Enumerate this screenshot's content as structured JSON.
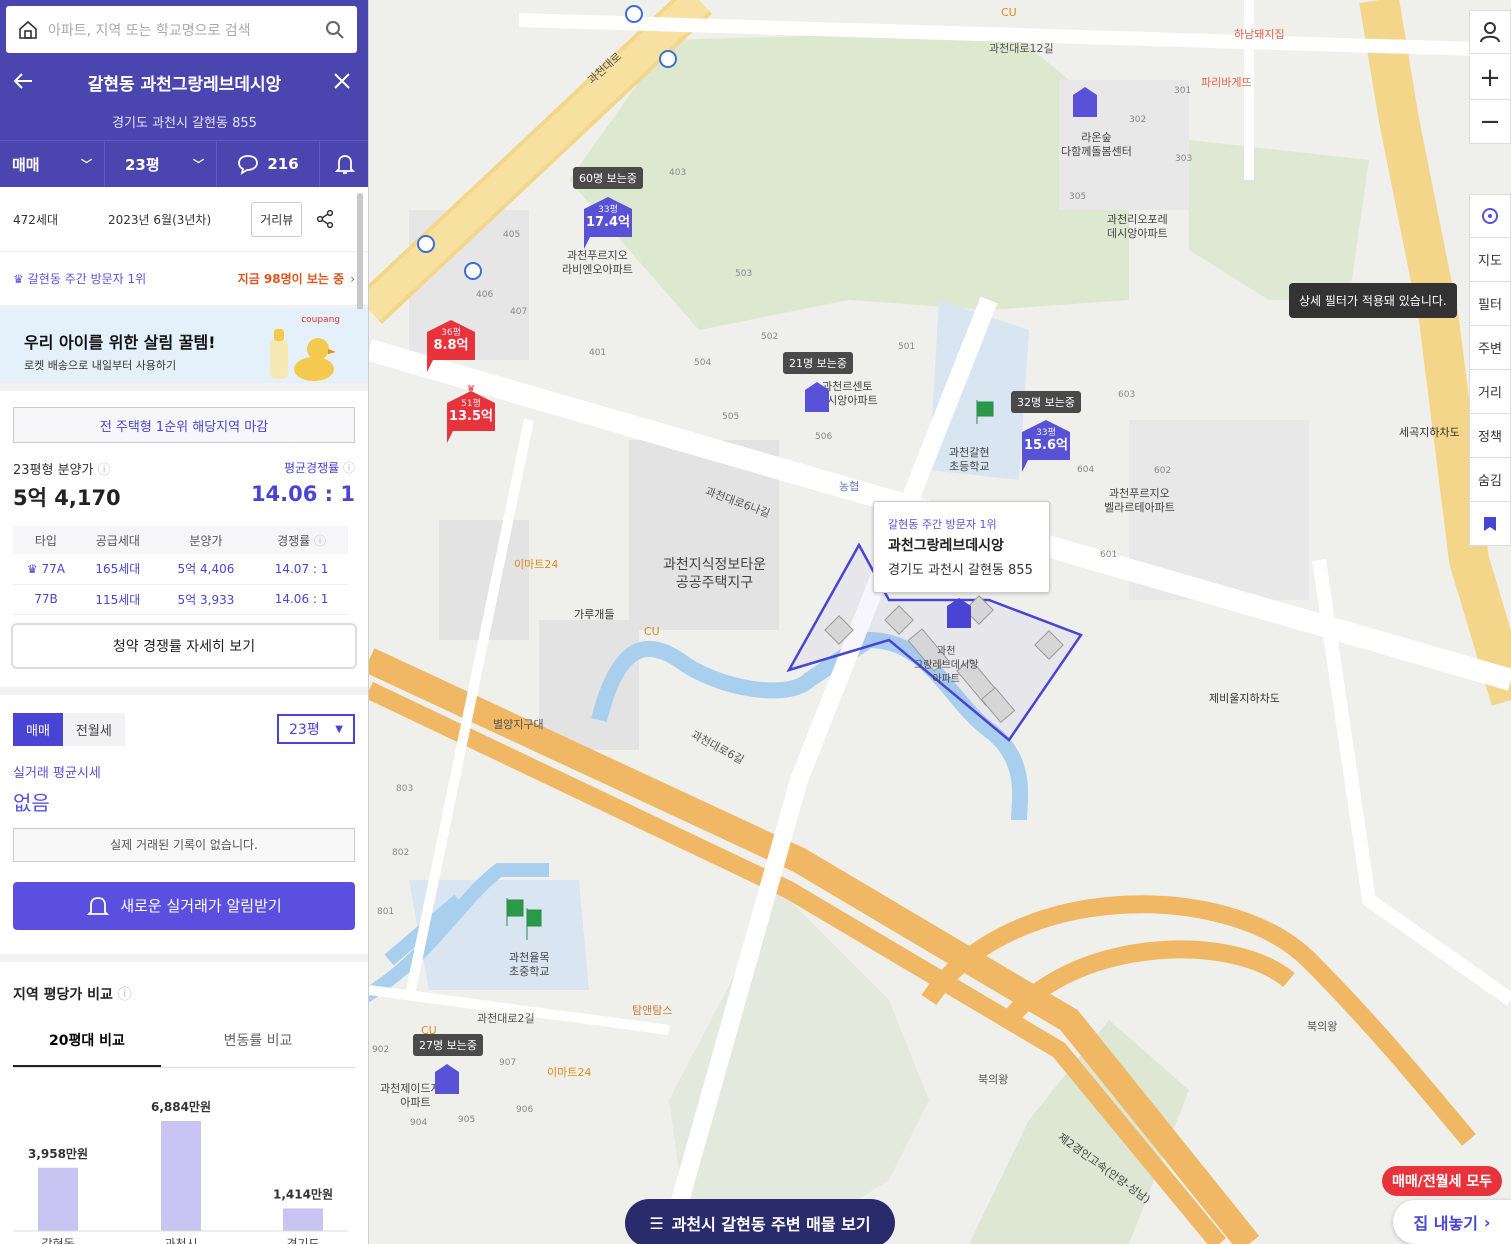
{
  "search": {
    "placeholder": "아파트, 지역 또는 학교명으로 검색"
  },
  "header": {
    "title": "갈현동 과천그랑레브데시앙",
    "address": "경기도 과천시 갈현동 855",
    "trade": "매매",
    "size": "23평",
    "comments": "216"
  },
  "info": {
    "households": "472세대",
    "built": "2023년 6월(3년차)",
    "street_view": "거리뷰"
  },
  "visit": {
    "rank": "갈현동 주간 방문자 1위",
    "now": "지금 98명이 보는 중"
  },
  "ad": {
    "title": "우리 아이를 위한 살림 꿀템!",
    "sub": "로켓 배송으로 내일부터 사용하기",
    "brand": "coupang"
  },
  "presale": {
    "deadline": "전 주택형 1순위 해당지역 마감",
    "label": "23평형 분양가",
    "avg_label": "평균경쟁률",
    "price": "5억 4,170",
    "ratio": "14.06 : 1",
    "columns": [
      "타입",
      "공급세대",
      "분양가",
      "경쟁률"
    ],
    "rows": [
      [
        "77A",
        "165세대",
        "5억 4,406",
        "14.07 : 1"
      ],
      [
        "77B",
        "115세대",
        "5억 3,933",
        "14.06 : 1"
      ]
    ],
    "detail_button": "청약 경쟁률 자세히 보기"
  },
  "trade": {
    "tab_sale": "매매",
    "tab_rent": "전월세",
    "size": "23평",
    "avg_label": "실거래 평균시세",
    "avg_value": "없음",
    "no_record": "실제 거래된 기록이 없습니다.",
    "alert_button": "새로운 실거래가 알림받기"
  },
  "compare": {
    "title": "지역 평당가 비교",
    "tab1": "20평대 비교",
    "tab2": "변동률 비교",
    "bars": [
      {
        "name": "갈현동",
        "value": 3958,
        "label": "3,958만원"
      },
      {
        "name": "과천시",
        "value": 6884,
        "label": "6,884만원"
      },
      {
        "name": "경기도",
        "value": 1414,
        "label": "1,414만원"
      }
    ]
  },
  "map": {
    "popup": {
      "badge": "갈현동 주간 방문자 1위",
      "name": "과천그랑레브데시앙",
      "address": "경기도 과천시 갈현동 855"
    },
    "pins": [
      {
        "size": "33평",
        "price": "17.4억",
        "color": "#5a52d6",
        "watch": "60명 보는중"
      },
      {
        "size": "36평",
        "price": "8.8억",
        "color": "#e8333d",
        "watch": ""
      },
      {
        "size": "51평",
        "price": "13.5억",
        "color": "#e8333d",
        "watch": ""
      },
      {
        "size": "33평",
        "price": "15.6억",
        "color": "#5a52d6",
        "watch": "32명 보는중"
      }
    ],
    "watch_21": "21명 보는중",
    "watch_27": "27명 보는중",
    "labels": {
      "l1": "과천푸르지오\n라비엔오아파트",
      "l2": "과천르센토\n데시앙아파트",
      "l3": "과천갈현\n초등학교",
      "l4": "과천푸르지오\n벨라르테아파트",
      "l5": "라온숲\n다함께돌봄센터",
      "l6": "과천리오포레\n데시앙아파트",
      "l7": "과천지식정보타운\n공공주택지구",
      "l8": "가루개들",
      "l9": "이마트24",
      "l10": "CU",
      "l11": "별양지구대",
      "l12": "과천율목\n초중학교",
      "l13": "탐앤탐스",
      "l14": "이마트24",
      "l15": "과천제이드자이\n아파트",
      "l16": "CU",
      "l17": "하남돼지집",
      "l18": "파리바게뜨",
      "l19": "농협",
      "l20": "제비울지하차도",
      "l21": "세곡지하차도",
      "l22": "북의왕",
      "l23": "북의왕",
      "l24": "제2경인고속(안양-성남)",
      "l25": "과천대로12길",
      "l26": "과천대로",
      "l27": "과천대로6길",
      "l28": "과천대로6나길",
      "l29": "과천대로2길",
      "l30": "CU",
      "l31": "과천\n그랑레브데시앙\n아파트"
    },
    "tooltip": "상세 필터가 적용돼 있습니다.",
    "side": [
      "지도",
      "필터",
      "주변",
      "거리",
      "정책",
      "숨김"
    ],
    "list_button": "과천시 갈현동 주변 매물 보기",
    "deal_pill": "매매/전월세 모두",
    "home_button": "집 내놓기"
  }
}
